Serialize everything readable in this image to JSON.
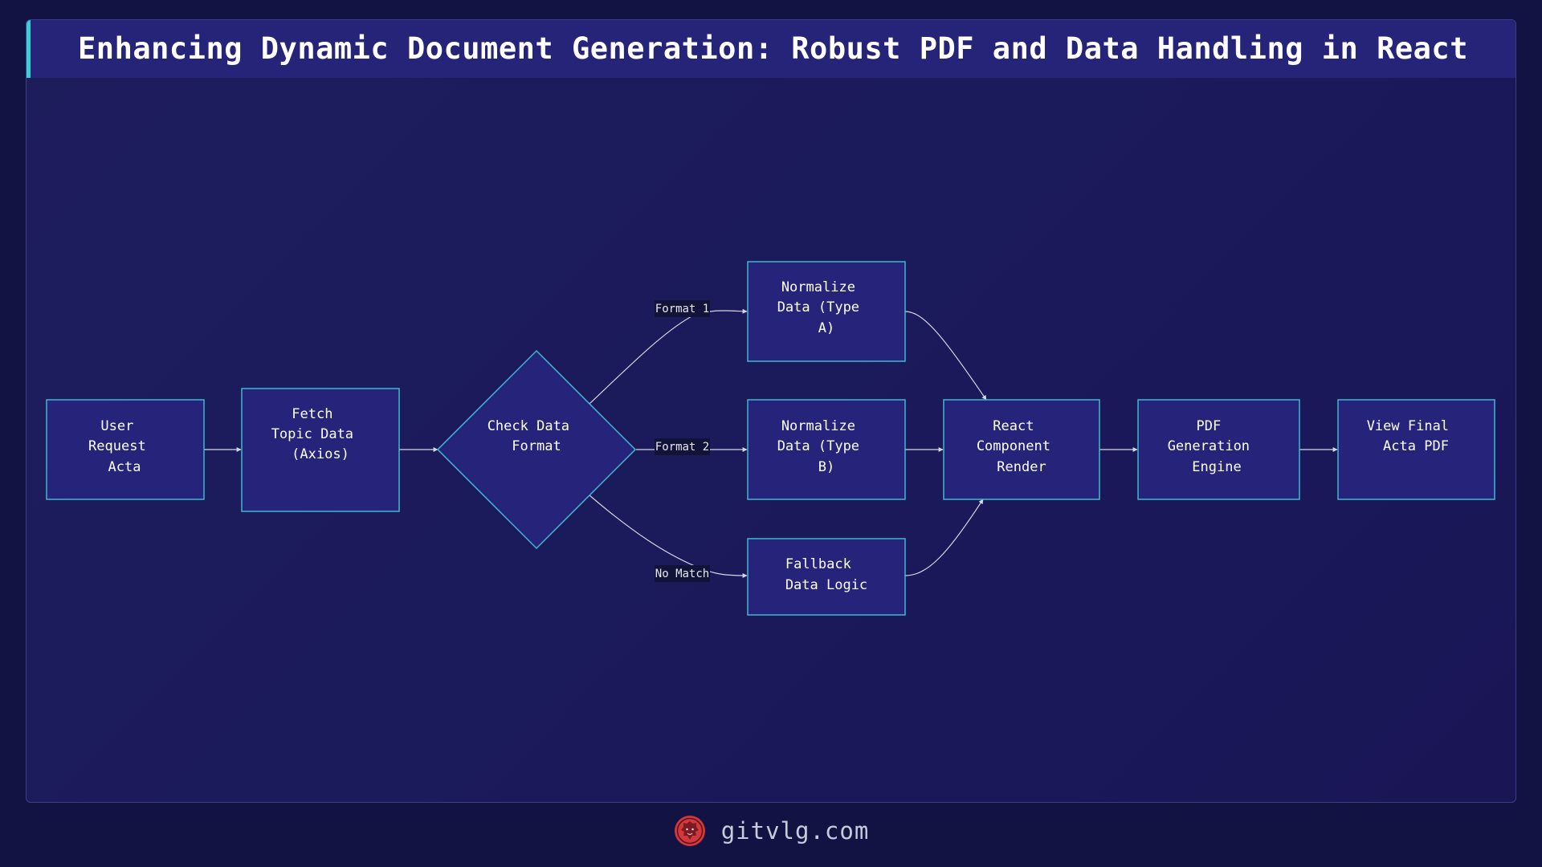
{
  "title": "Enhancing Dynamic Document Generation: Robust PDF and Data Handling in React",
  "colors": {
    "background": "#121342",
    "panel": "#1c1b5b",
    "title_bar": "#252478",
    "accent": "#38d0d8",
    "node_fill": "#25247a",
    "node_stroke": "#3fb8d0",
    "edge": "#d5d7e6",
    "logo": "#d2383c"
  },
  "nodes": {
    "user_request": [
      "User",
      "Request",
      "Acta"
    ],
    "fetch_topic": [
      "Fetch",
      "Topic Data",
      "(Axios)"
    ],
    "check_format": [
      "Check Data",
      "Format"
    ],
    "normalize_a": [
      "Normalize",
      "Data (Type",
      "A)"
    ],
    "normalize_b": [
      "Normalize",
      "Data (Type",
      "B)"
    ],
    "fallback": [
      "Fallback",
      "Data Logic"
    ],
    "react_render": [
      "React",
      "Component",
      "Render"
    ],
    "pdf_engine": [
      "PDF",
      "Generation",
      "Engine"
    ],
    "view_pdf": [
      "View Final",
      "Acta PDF"
    ]
  },
  "edge_labels": {
    "format1": "Format 1",
    "format2": "Format 2",
    "no_match": "No Match"
  },
  "footer": {
    "text": "gitvlg.com",
    "logo_icon": "lion-head-icon"
  }
}
